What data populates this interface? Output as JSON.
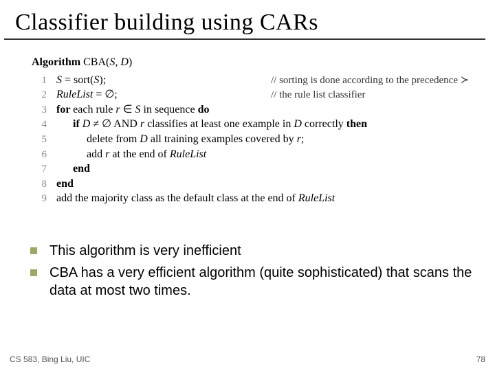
{
  "title": "Classifier building using CARs",
  "algorithm": {
    "header_prefix": "Algorithm",
    "header_name": " CBA(",
    "header_args": "S, D",
    "header_suffix": ")",
    "lines": [
      {
        "n": "1",
        "body_a": "S",
        "body_b": " = sort(",
        "body_c": "S",
        "body_d": ");",
        "comment": "// sorting is done according to the precedence ≻"
      },
      {
        "n": "2",
        "body_a": "RuleList",
        "body_b": " = ∅;",
        "comment": "// the rule list classifier"
      },
      {
        "n": "3",
        "kw": "for ",
        "body_a": "each rule ",
        "body_b": "r",
        "body_c": " ∈ ",
        "body_d": "S",
        "body_e": " in sequence ",
        "kw2": "do"
      },
      {
        "n": "4",
        "indent": "      ",
        "kw": "if ",
        "body_a": "D",
        "body_b": " ≠ ∅ AND ",
        "body_c": "r",
        "body_d": " classifies at least one example in ",
        "body_e": "D",
        "body_f": " correctly ",
        "kw2": "then"
      },
      {
        "n": "5",
        "indent": "           ",
        "body_a": "delete from ",
        "body_b": "D",
        "body_c": " all training examples covered by ",
        "body_d": "r",
        "body_e": ";"
      },
      {
        "n": "6",
        "indent": "           ",
        "body_a": "add ",
        "body_b": "r",
        "body_c": " at the end of ",
        "body_d": "RuleList"
      },
      {
        "n": "7",
        "indent": "      ",
        "kw": "end"
      },
      {
        "n": "8",
        "kw": "end"
      },
      {
        "n": "9",
        "body_a": "add the majority class as the default class at the end of ",
        "body_b": "RuleList"
      }
    ]
  },
  "bullets": [
    "This algorithm is very inefficient",
    "CBA has a very efficient algorithm (quite sophisticated) that scans the data at most two times."
  ],
  "footer": {
    "left": "CS 583, Bing Liu, UIC",
    "right": "78"
  }
}
